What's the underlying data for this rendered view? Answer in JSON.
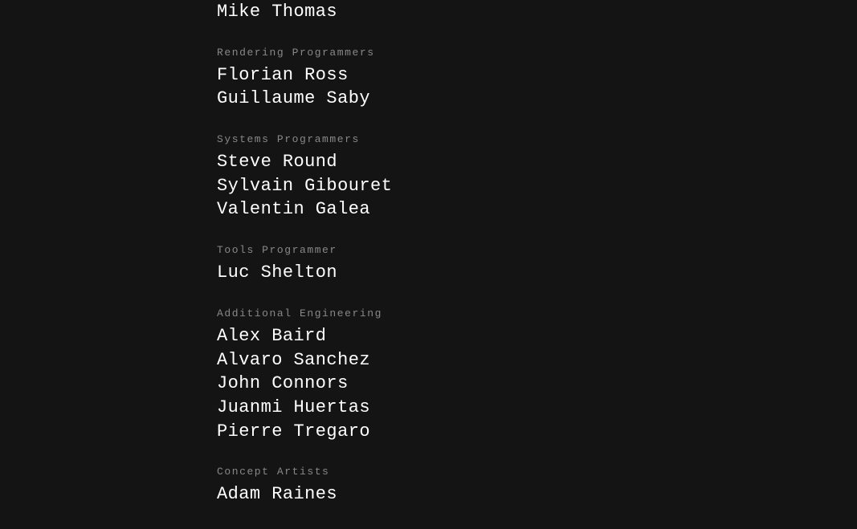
{
  "credits": {
    "partial_top": {
      "name": "Mike Thomas"
    },
    "sections": [
      {
        "id": "rendering-programmers",
        "title": "Rendering Programmers",
        "names": [
          "Florian Ross",
          "Guillaume Saby"
        ]
      },
      {
        "id": "systems-programmers",
        "title": "Systems Programmers",
        "names": [
          "Steve Round",
          "Sylvain Gibouret",
          "Valentin Galea"
        ]
      },
      {
        "id": "tools-programmer",
        "title": "Tools Programmer",
        "names": [
          "Luc Shelton"
        ]
      },
      {
        "id": "additional-engineering",
        "title": "Additional Engineering",
        "names": [
          "Alex Baird",
          "Alvaro Sanchez",
          "John Connors",
          "Juanmi Huertas",
          "Pierre Tregaro"
        ]
      },
      {
        "id": "concept-artists",
        "title": "Concept Artists",
        "names": [
          "Adam Raines"
        ]
      }
    ]
  }
}
